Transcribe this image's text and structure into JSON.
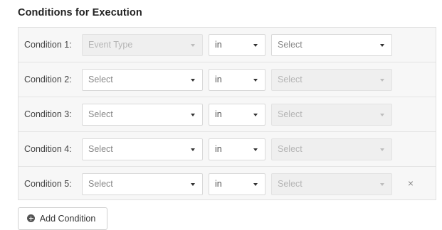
{
  "section": {
    "title": "Conditions for Execution"
  },
  "conditions": [
    {
      "label": "Condition 1:",
      "field": "Event Type",
      "operator": "in",
      "value": "Select",
      "field_disabled": true,
      "value_disabled": false,
      "removable": false
    },
    {
      "label": "Condition 2:",
      "field": "Select",
      "operator": "in",
      "value": "Select",
      "field_disabled": false,
      "value_disabled": true,
      "removable": false
    },
    {
      "label": "Condition 3:",
      "field": "Select",
      "operator": "in",
      "value": "Select",
      "field_disabled": false,
      "value_disabled": true,
      "removable": false
    },
    {
      "label": "Condition 4:",
      "field": "Select",
      "operator": "in",
      "value": "Select",
      "field_disabled": false,
      "value_disabled": true,
      "removable": false
    },
    {
      "label": "Condition 5:",
      "field": "Select",
      "operator": "in",
      "value": "Select",
      "field_disabled": false,
      "value_disabled": true,
      "removable": true
    }
  ],
  "remove_symbol": "×",
  "add_button": {
    "label": "Add Condition"
  }
}
